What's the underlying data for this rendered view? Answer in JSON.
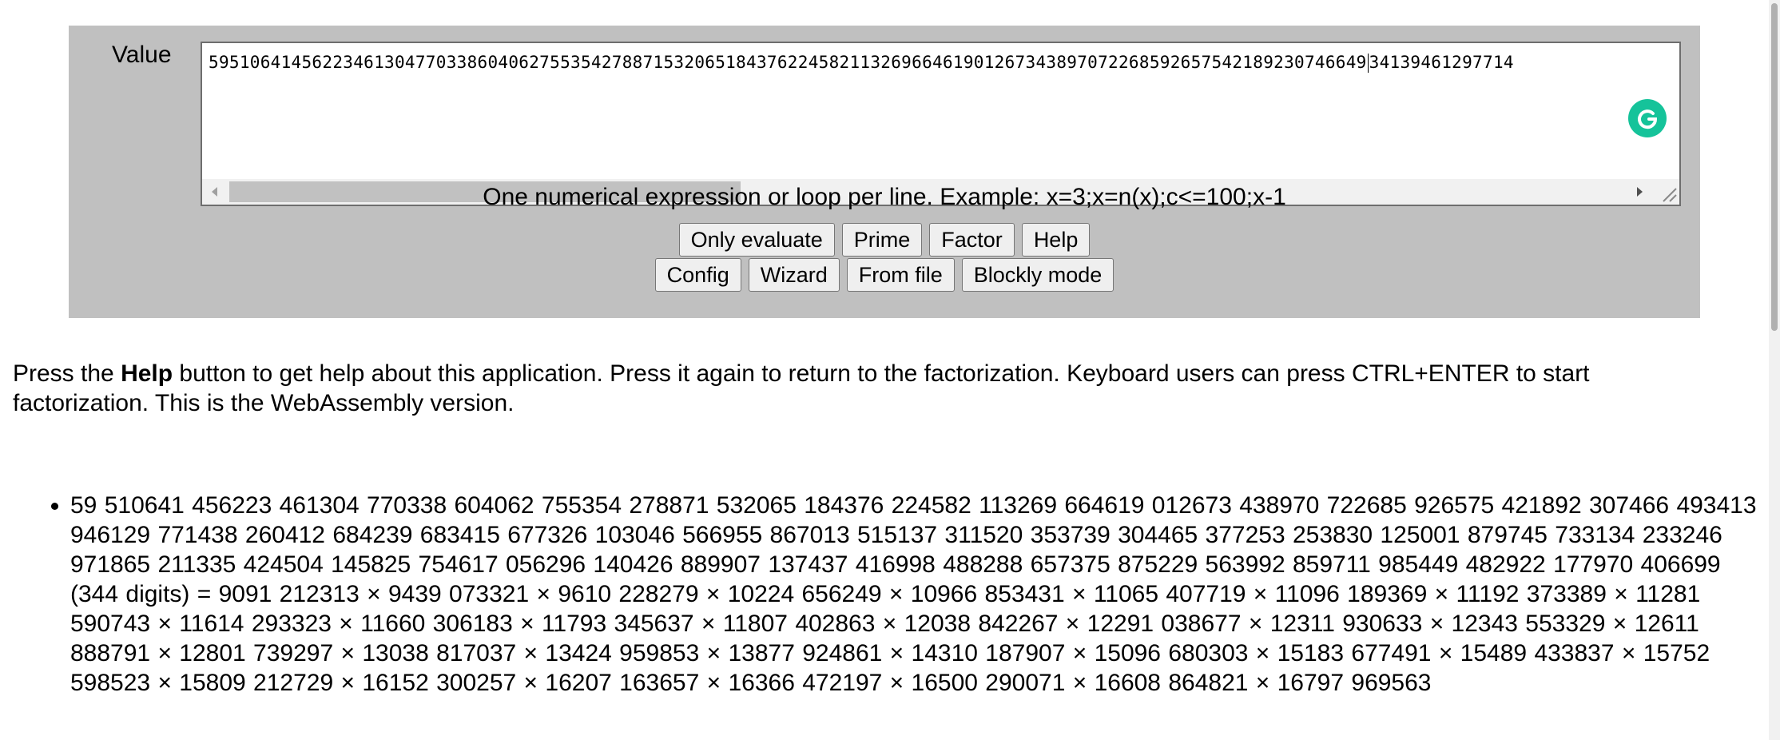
{
  "form": {
    "value_label": "Value",
    "value_text_before_caret": "5951064145622346130477033860406275535427887153206518437622458211326966461901267343897072268592657542189230746649",
    "value_text_after_caret": "34139461297714",
    "hint": "One numerical expression or loop per line. Example: x=3;x=n(x);c<=100;x-1"
  },
  "buttons": {
    "row1": [
      "Only evaluate",
      "Prime",
      "Factor",
      "Help"
    ],
    "row2": [
      "Config",
      "Wizard",
      "From file",
      "Blockly mode"
    ]
  },
  "help_text": {
    "press": "Press the ",
    "help_word": "Help",
    "rest": " button to get help about this application. Press it again to return to the factorization. Keyboard users can press CTRL+ENTER to start factorization. This is the WebAssembly version."
  },
  "results": [
    "59 510641 456223 461304 770338 604062 755354 278871 532065 184376 224582 113269 664619 012673 438970 722685 926575 421892 307466 493413 946129 771438 260412 684239 683415 677326 103046 566955 867013 515137 311520 353739 304465 377253 253830 125001 879745 733134 233246 971865 211335 424504 145825 754617 056296 140426 889907 137437 416998 488288 657375 875229 563992 859711 985449 482922 177970 406699 (344 digits) = 9091 212313 × 9439 073321 × 9610 228279 × 10224 656249 × 10966 853431 × 11065 407719 × 11096 189369 × 11192 373389 × 11281 590743 × 11614 293323 × 11660 306183 × 11793 345637 × 11807 402863 × 12038 842267 × 12291 038677 × 12311 930633 × 12343 553329 × 12611 888791 × 12801 739297 × 13038 817037 × 13424 959853 × 13877 924861 × 14310 187907 × 15096 680303 × 15183 677491 × 15489 433837 × 15752 598523 × 15809 212729 × 16152 300257 × 16207 163657 × 16366 472197 × 16500 290071 × 16608 864821 × 16797 969563"
  ],
  "colors": {
    "panel": "#c0c0c0",
    "grammarly": "#15c39a"
  },
  "icons": {
    "grammarly": "grammarly-icon",
    "scroll_left": "scroll-left-icon",
    "scroll_right": "scroll-right-icon",
    "resize": "resize-grip-icon"
  }
}
